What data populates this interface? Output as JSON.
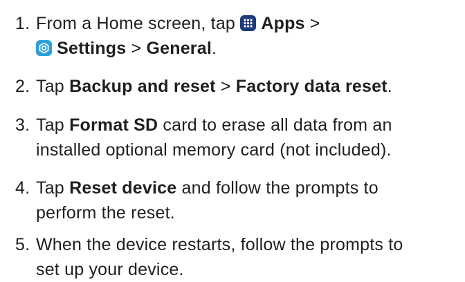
{
  "steps": [
    {
      "number": "1.",
      "prefix": "From a Home screen, tap ",
      "apps_icon": "apps-grid-icon",
      "apps_label": "Apps",
      "sep1": " >",
      "settings_icon": "settings-gear-icon",
      "settings_label": "Settings",
      "sep2": " > ",
      "general_label": "General",
      "suffix": "."
    },
    {
      "number": "2.",
      "prefix": "Tap ",
      "bold1": "Backup and reset",
      "sep": " > ",
      "bold2": "Factory data reset",
      "suffix": "."
    },
    {
      "number": "3.",
      "prefix": "Tap ",
      "bold1": "Format SD",
      "line1_rest": " card to erase all data from an",
      "line2": "installed optional memory card (not included)."
    },
    {
      "number": "4.",
      "prefix": "Tap ",
      "bold1": "Reset device",
      "line1_rest": " and follow the prompts to",
      "line2": "perform the reset."
    },
    {
      "number": "5.",
      "line1": "When the device restarts, follow the prompts to",
      "line2": "set up your device."
    }
  ],
  "colors": {
    "text": "#1f1f1f",
    "apps_icon_bg": "#1d3a7a",
    "settings_icon_bg": "#2a9fd8"
  }
}
